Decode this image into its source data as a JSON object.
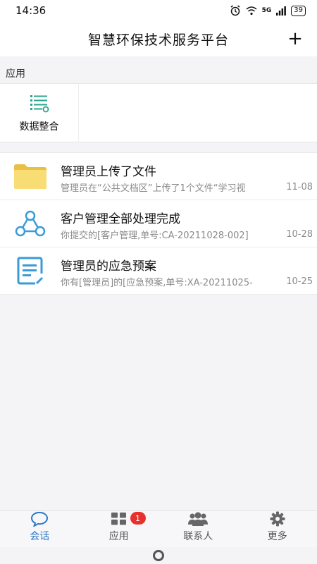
{
  "status_bar": {
    "time": "14:36",
    "network": "5G",
    "battery": "39"
  },
  "header": {
    "title": "智慧环保技术服务平台",
    "add_label": "+"
  },
  "apps_section": {
    "label": "应用",
    "items": [
      {
        "label": "数据整合",
        "icon": "data-integration-icon"
      }
    ]
  },
  "messages": [
    {
      "title": "管理员上传了文件",
      "desc": "管理员在“公共文档区”上传了1个文件“学习视",
      "date": "11-08",
      "icon": "folder-icon"
    },
    {
      "title": "客户管理全部处理完成",
      "desc": "你提交的[客户管理,单号:CA-20211028-002]",
      "date": "10-28",
      "icon": "network-icon"
    },
    {
      "title": "管理员的应急预案",
      "desc": "你有[管理员]的[应急预案,单号:XA-20211025-",
      "date": "10-25",
      "icon": "document-icon"
    }
  ],
  "tabs": [
    {
      "label": "会话",
      "icon": "chat-icon",
      "active": true
    },
    {
      "label": "应用",
      "icon": "grid-icon",
      "badge": "1"
    },
    {
      "label": "联系人",
      "icon": "contacts-icon"
    },
    {
      "label": "更多",
      "icon": "gear-icon"
    }
  ],
  "colors": {
    "accent": "#2a78c8",
    "badge": "#e8312e",
    "folder": "#f6d768",
    "icon_blue": "#3a9bd6"
  }
}
